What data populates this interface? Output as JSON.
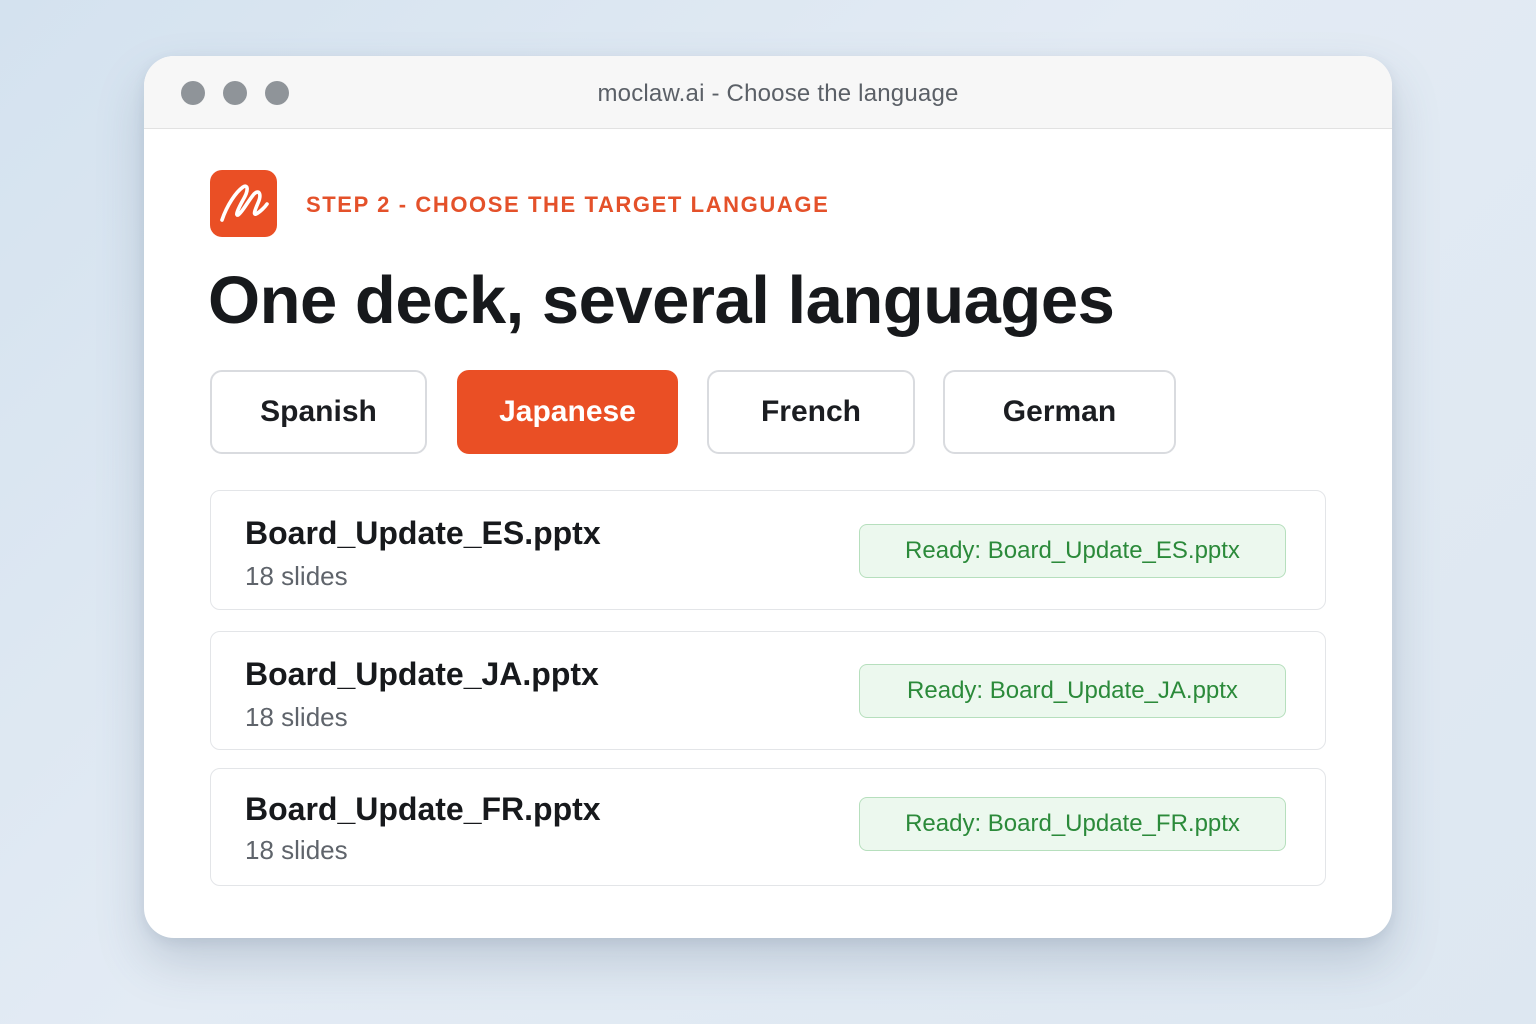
{
  "window": {
    "title": "moclaw.ai - Choose the language",
    "controls": [
      "window-close-dot",
      "window-minimize-dot",
      "window-zoom-dot"
    ]
  },
  "brand": {
    "logo_icon": "signature-scribble-icon",
    "accent_color": "#ea4f25"
  },
  "header": {
    "step_label": "STEP 2 - CHOOSE THE TARGET LANGUAGE",
    "headline": "One deck, several languages"
  },
  "languages": {
    "selected": "Japanese",
    "options": [
      {
        "label": "Spanish"
      },
      {
        "label": "Japanese"
      },
      {
        "label": "French"
      },
      {
        "label": "German"
      }
    ]
  },
  "files": [
    {
      "name": "Board_Update_ES.pptx",
      "meta": "18 slides",
      "status": "Ready: Board_Update_ES.pptx"
    },
    {
      "name": "Board_Update_JA.pptx",
      "meta": "18 slides",
      "status": "Ready: Board_Update_JA.pptx"
    },
    {
      "name": "Board_Update_FR.pptx",
      "meta": "18 slides",
      "status": "Ready: Board_Update_FR.pptx"
    }
  ],
  "colors": {
    "status_text": "#2b8a3a",
    "status_background": "#ecf8ee",
    "headline": "#17191c"
  }
}
